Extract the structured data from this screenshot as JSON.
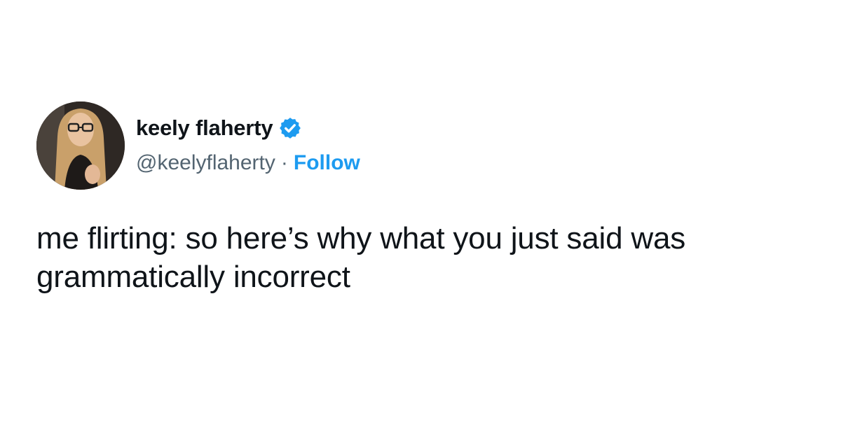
{
  "tweet": {
    "display_name": "keely flaherty",
    "handle": "@keelyflaherty",
    "separator": "·",
    "follow_label": "Follow",
    "text": "me flirting: so here’s why what you just said was grammatically incorrect",
    "verified": true
  },
  "icons": {
    "verified": "verified-badge-icon",
    "avatar": "profile-photo"
  },
  "colors": {
    "accent": "#1d9bf0",
    "text_primary": "#0f1419",
    "text_secondary": "#536471",
    "background": "#ffffff"
  }
}
